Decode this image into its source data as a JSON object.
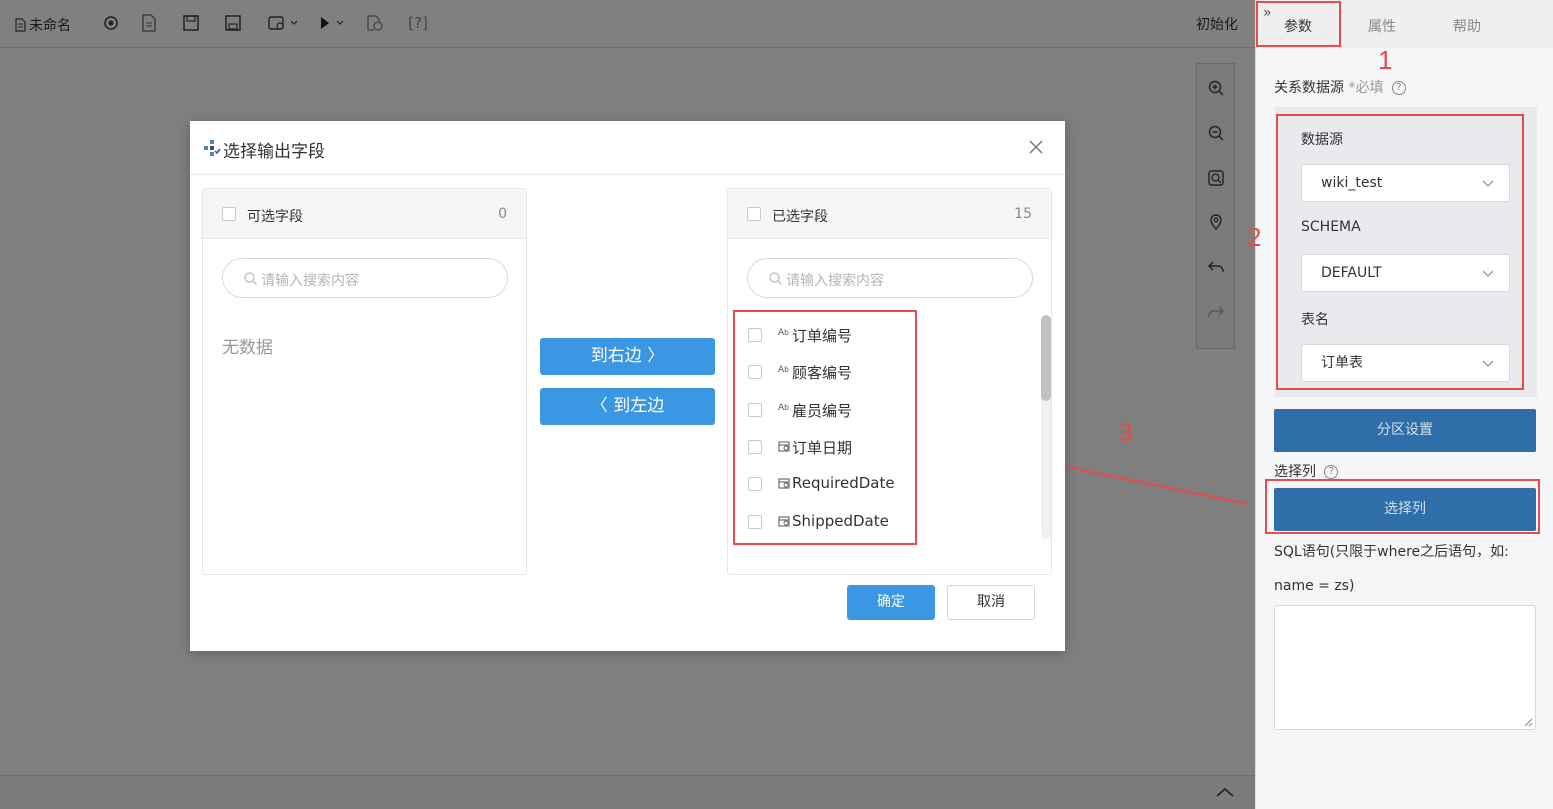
{
  "toolbar": {
    "title": "未命名",
    "help_label": "[?]",
    "init_label": "初始化"
  },
  "right_panel": {
    "tabs": [
      {
        "label": "参数",
        "active": true
      },
      {
        "label": "属性",
        "active": false
      },
      {
        "label": "帮助",
        "active": false
      }
    ],
    "datasource_label": "关系数据源",
    "required_text": "*必填",
    "fields": {
      "datasource": {
        "label": "数据源",
        "value": "wiki_test"
      },
      "schema": {
        "label": "SCHEMA",
        "value": "DEFAULT"
      },
      "table": {
        "label": "表名",
        "value": "订单表"
      }
    },
    "partition_button": "分区设置",
    "select_columns_label": "选择列",
    "select_columns_button": "选择列",
    "sql_label_line1": "SQL语句(只限于where之后语句，如:",
    "sql_label_line2": "name = zs)",
    "sql_value": ""
  },
  "annotations": {
    "n1": "1",
    "n2": "2",
    "n3": "3",
    "color": "#e84b4b"
  },
  "modal": {
    "title": "选择输出字段",
    "left_panel": {
      "title": "可选字段",
      "count": "0",
      "search_placeholder": "请输入搜索内容",
      "empty_text": "无数据"
    },
    "to_right_label": "到右边 〉",
    "to_left_label": "〈 到左边",
    "right_panel": {
      "title": "已选字段",
      "count": "15",
      "search_placeholder": "请输入搜索内容",
      "items": [
        {
          "type_icon": "text-type-icon",
          "label": "订单编号"
        },
        {
          "type_icon": "text-type-icon",
          "label": "顾客编号"
        },
        {
          "type_icon": "text-type-icon",
          "label": "雇员编号"
        },
        {
          "type_icon": "date-type-icon",
          "label": "订单日期"
        },
        {
          "type_icon": "date-type-icon",
          "label": "RequiredDate"
        },
        {
          "type_icon": "date-type-icon",
          "label": "ShippedDate"
        }
      ]
    },
    "confirm_label": "确定",
    "cancel_label": "取消"
  },
  "colors": {
    "primary": "#3b97e3",
    "dark_button": "#2f6ea8",
    "overlay": "#7f7f7f"
  }
}
